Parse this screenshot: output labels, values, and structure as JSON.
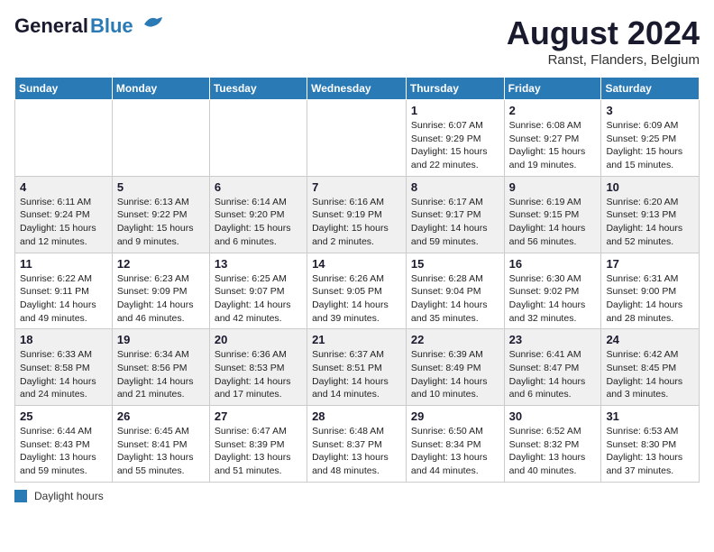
{
  "header": {
    "logo_general": "General",
    "logo_blue": "Blue",
    "month_year": "August 2024",
    "location": "Ranst, Flanders, Belgium"
  },
  "weekdays": [
    "Sunday",
    "Monday",
    "Tuesday",
    "Wednesday",
    "Thursday",
    "Friday",
    "Saturday"
  ],
  "weeks": [
    [
      {
        "day": "",
        "info": ""
      },
      {
        "day": "",
        "info": ""
      },
      {
        "day": "",
        "info": ""
      },
      {
        "day": "",
        "info": ""
      },
      {
        "day": "1",
        "info": "Sunrise: 6:07 AM\nSunset: 9:29 PM\nDaylight: 15 hours\nand 22 minutes."
      },
      {
        "day": "2",
        "info": "Sunrise: 6:08 AM\nSunset: 9:27 PM\nDaylight: 15 hours\nand 19 minutes."
      },
      {
        "day": "3",
        "info": "Sunrise: 6:09 AM\nSunset: 9:25 PM\nDaylight: 15 hours\nand 15 minutes."
      }
    ],
    [
      {
        "day": "4",
        "info": "Sunrise: 6:11 AM\nSunset: 9:24 PM\nDaylight: 15 hours\nand 12 minutes."
      },
      {
        "day": "5",
        "info": "Sunrise: 6:13 AM\nSunset: 9:22 PM\nDaylight: 15 hours\nand 9 minutes."
      },
      {
        "day": "6",
        "info": "Sunrise: 6:14 AM\nSunset: 9:20 PM\nDaylight: 15 hours\nand 6 minutes."
      },
      {
        "day": "7",
        "info": "Sunrise: 6:16 AM\nSunset: 9:19 PM\nDaylight: 15 hours\nand 2 minutes."
      },
      {
        "day": "8",
        "info": "Sunrise: 6:17 AM\nSunset: 9:17 PM\nDaylight: 14 hours\nand 59 minutes."
      },
      {
        "day": "9",
        "info": "Sunrise: 6:19 AM\nSunset: 9:15 PM\nDaylight: 14 hours\nand 56 minutes."
      },
      {
        "day": "10",
        "info": "Sunrise: 6:20 AM\nSunset: 9:13 PM\nDaylight: 14 hours\nand 52 minutes."
      }
    ],
    [
      {
        "day": "11",
        "info": "Sunrise: 6:22 AM\nSunset: 9:11 PM\nDaylight: 14 hours\nand 49 minutes."
      },
      {
        "day": "12",
        "info": "Sunrise: 6:23 AM\nSunset: 9:09 PM\nDaylight: 14 hours\nand 46 minutes."
      },
      {
        "day": "13",
        "info": "Sunrise: 6:25 AM\nSunset: 9:07 PM\nDaylight: 14 hours\nand 42 minutes."
      },
      {
        "day": "14",
        "info": "Sunrise: 6:26 AM\nSunset: 9:05 PM\nDaylight: 14 hours\nand 39 minutes."
      },
      {
        "day": "15",
        "info": "Sunrise: 6:28 AM\nSunset: 9:04 PM\nDaylight: 14 hours\nand 35 minutes."
      },
      {
        "day": "16",
        "info": "Sunrise: 6:30 AM\nSunset: 9:02 PM\nDaylight: 14 hours\nand 32 minutes."
      },
      {
        "day": "17",
        "info": "Sunrise: 6:31 AM\nSunset: 9:00 PM\nDaylight: 14 hours\nand 28 minutes."
      }
    ],
    [
      {
        "day": "18",
        "info": "Sunrise: 6:33 AM\nSunset: 8:58 PM\nDaylight: 14 hours\nand 24 minutes."
      },
      {
        "day": "19",
        "info": "Sunrise: 6:34 AM\nSunset: 8:56 PM\nDaylight: 14 hours\nand 21 minutes."
      },
      {
        "day": "20",
        "info": "Sunrise: 6:36 AM\nSunset: 8:53 PM\nDaylight: 14 hours\nand 17 minutes."
      },
      {
        "day": "21",
        "info": "Sunrise: 6:37 AM\nSunset: 8:51 PM\nDaylight: 14 hours\nand 14 minutes."
      },
      {
        "day": "22",
        "info": "Sunrise: 6:39 AM\nSunset: 8:49 PM\nDaylight: 14 hours\nand 10 minutes."
      },
      {
        "day": "23",
        "info": "Sunrise: 6:41 AM\nSunset: 8:47 PM\nDaylight: 14 hours\nand 6 minutes."
      },
      {
        "day": "24",
        "info": "Sunrise: 6:42 AM\nSunset: 8:45 PM\nDaylight: 14 hours\nand 3 minutes."
      }
    ],
    [
      {
        "day": "25",
        "info": "Sunrise: 6:44 AM\nSunset: 8:43 PM\nDaylight: 13 hours\nand 59 minutes."
      },
      {
        "day": "26",
        "info": "Sunrise: 6:45 AM\nSunset: 8:41 PM\nDaylight: 13 hours\nand 55 minutes."
      },
      {
        "day": "27",
        "info": "Sunrise: 6:47 AM\nSunset: 8:39 PM\nDaylight: 13 hours\nand 51 minutes."
      },
      {
        "day": "28",
        "info": "Sunrise: 6:48 AM\nSunset: 8:37 PM\nDaylight: 13 hours\nand 48 minutes."
      },
      {
        "day": "29",
        "info": "Sunrise: 6:50 AM\nSunset: 8:34 PM\nDaylight: 13 hours\nand 44 minutes."
      },
      {
        "day": "30",
        "info": "Sunrise: 6:52 AM\nSunset: 8:32 PM\nDaylight: 13 hours\nand 40 minutes."
      },
      {
        "day": "31",
        "info": "Sunrise: 6:53 AM\nSunset: 8:30 PM\nDaylight: 13 hours\nand 37 minutes."
      }
    ]
  ],
  "legend": {
    "box_color": "#2a7ab5",
    "label": "Daylight hours"
  }
}
